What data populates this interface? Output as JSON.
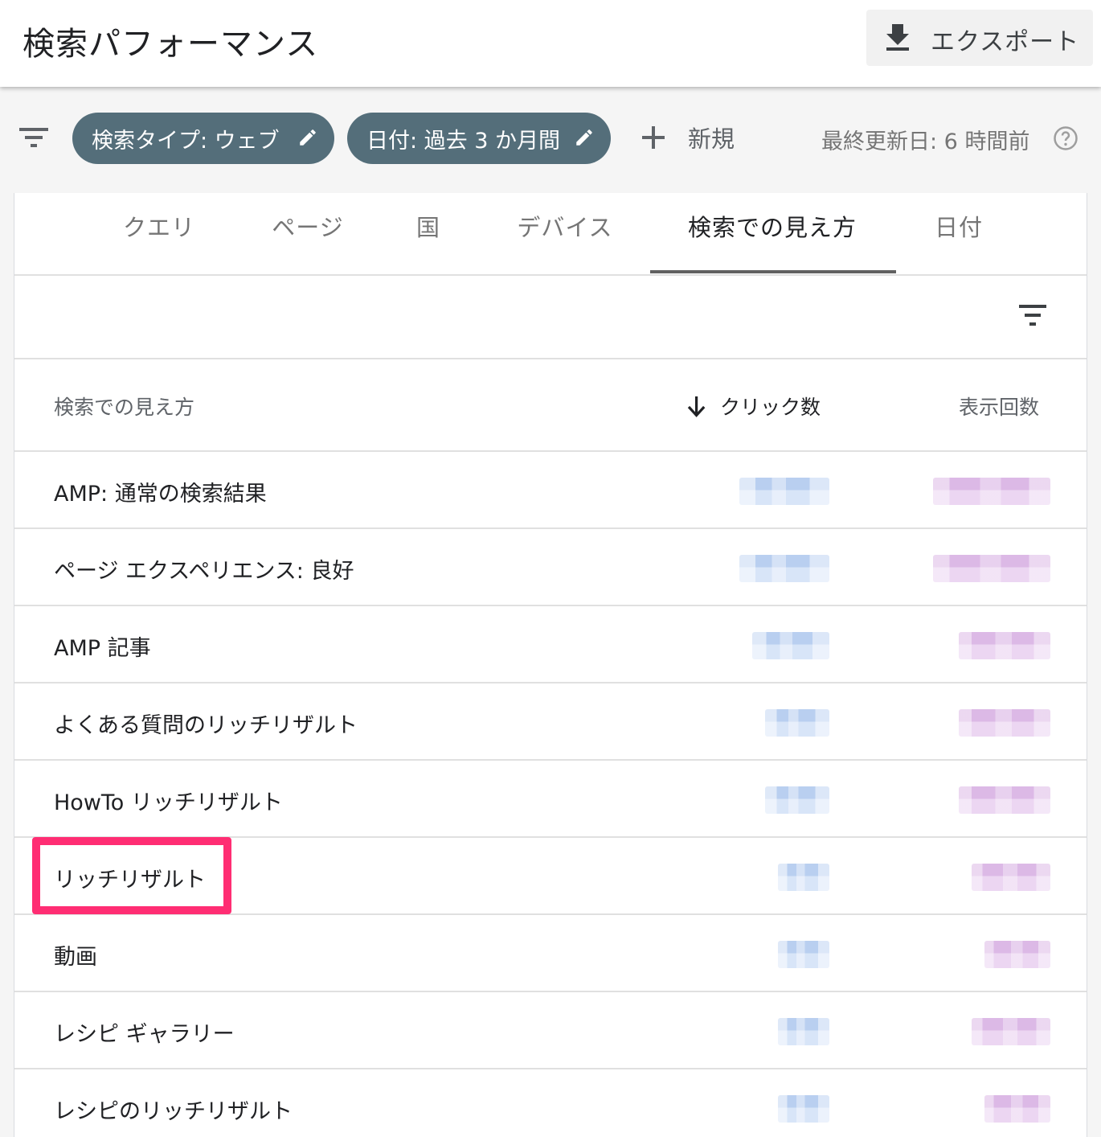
{
  "header": {
    "title": "検索パフォーマンス",
    "export_label": "エクスポート"
  },
  "filters": {
    "search_type_chip": "検索タイプ: ウェブ",
    "date_chip": "日付: 過去 3 か月間",
    "new_label": "新規",
    "last_updated": "最終更新日: 6 時間前"
  },
  "tabs": [
    {
      "label": "クエリ",
      "active": false
    },
    {
      "label": "ページ",
      "active": false
    },
    {
      "label": "国",
      "active": false
    },
    {
      "label": "デバイス",
      "active": false
    },
    {
      "label": "検索での見え方",
      "active": true
    },
    {
      "label": "日付",
      "active": false
    }
  ],
  "table": {
    "columns": {
      "name": "検索での見え方",
      "clicks": "クリック数",
      "impressions": "表示回数"
    },
    "sort": {
      "column": "clicks",
      "direction": "descending"
    },
    "rows": [
      {
        "name": "AMP: 通常の検索結果",
        "clicks_blurred": true,
        "impressions_blurred": true
      },
      {
        "name": "ページ エクスペリエンス: 良好",
        "clicks_blurred": true,
        "impressions_blurred": true
      },
      {
        "name": "AMP 記事",
        "clicks_blurred": true,
        "impressions_blurred": true
      },
      {
        "name": "よくある質問のリッチリザルト",
        "clicks_blurred": true,
        "impressions_blurred": true
      },
      {
        "name": "HowTo リッチリザルト",
        "clicks_blurred": true,
        "impressions_blurred": true
      },
      {
        "name": "リッチリザルト",
        "clicks_blurred": true,
        "impressions_blurred": true,
        "highlighted": true
      },
      {
        "name": "動画",
        "clicks_blurred": true,
        "impressions_blurred": true
      },
      {
        "name": "レシピ ギャラリー",
        "clicks_blurred": true,
        "impressions_blurred": true
      },
      {
        "name": "レシピのリッチリザルト",
        "clicks_blurred": true,
        "impressions_blurred": true
      }
    ]
  },
  "colors": {
    "chip_background": "#546e7a",
    "highlight_border": "#ff2d73",
    "active_tab_underline": "#616161"
  },
  "icons": {
    "export": "download-icon",
    "filter": "filter-list-icon",
    "chip_edit": "pencil-icon",
    "new": "plus-icon",
    "help": "help-circle-icon",
    "sort": "arrow-down-icon"
  }
}
